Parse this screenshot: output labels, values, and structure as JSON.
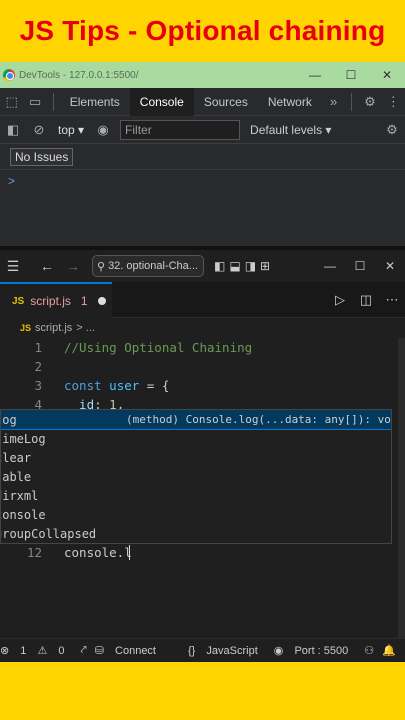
{
  "banner": {
    "title": "JS Tips - Optional chaining"
  },
  "devtools": {
    "window_title": "DevTools - 127.0.0.1:5500/",
    "tabs": [
      "Elements",
      "Console",
      "Sources",
      "Network"
    ],
    "active_tab": "Console",
    "context": "top",
    "filter_placeholder": "Filter",
    "levels": "Default levels",
    "issues": "No Issues",
    "prompt": ">"
  },
  "vscode": {
    "search": "32. optional-Cha...",
    "tab": {
      "name": "script.js",
      "problems": "1",
      "lang": "JS"
    },
    "breadcrumb": "script.js",
    "breadcrumb_sep": ">",
    "lines": [
      {
        "n": "1",
        "parts": [
          {
            "t": "//Using Optional Chaining",
            "c": "comment"
          }
        ]
      },
      {
        "n": "2",
        "parts": []
      },
      {
        "n": "3",
        "parts": [
          {
            "t": "const",
            "c": "keyword"
          },
          {
            "t": " ",
            "c": "plain"
          },
          {
            "t": "user",
            "c": "var"
          },
          {
            "t": " = {",
            "c": "plain"
          }
        ]
      },
      {
        "n": "4",
        "parts": [
          {
            "t": "  id",
            "c": "prop"
          },
          {
            "t": ": ",
            "c": "plain"
          },
          {
            "t": "1",
            "c": "num"
          },
          {
            "t": ",",
            "c": "plain"
          }
        ]
      },
      {
        "n": "12",
        "parts": [
          {
            "t": "console.l",
            "c": "plain"
          }
        ]
      }
    ],
    "suggestions": [
      {
        "label": "log",
        "detail": "(method) Console.log(...data: any[]): void"
      },
      {
        "label": "timeLog",
        "detail": ""
      },
      {
        "label": "clear",
        "detail": ""
      },
      {
        "label": "table",
        "detail": ""
      },
      {
        "label": "dirxml",
        "detail": ""
      },
      {
        "label": "console",
        "detail": ""
      },
      {
        "label": "groupCollapsed",
        "detail": ""
      }
    ],
    "status": {
      "errors": "1",
      "warnings": "0",
      "connect": "Connect",
      "language": "JavaScript",
      "port": "Port : 5500"
    }
  },
  "colors": {
    "banner_bg": "#ffd400",
    "banner_text": "#e60012",
    "accent": "#0078d4"
  }
}
